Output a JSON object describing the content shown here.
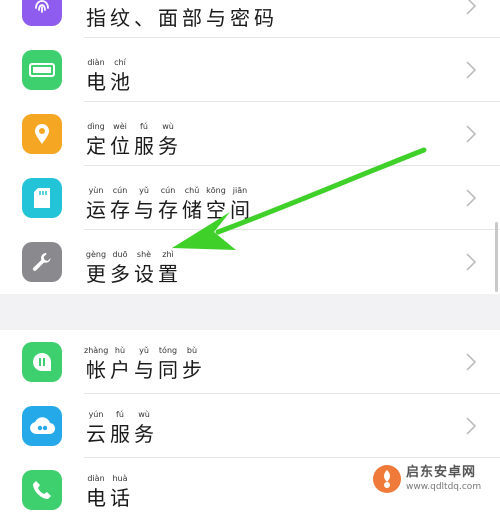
{
  "settings": {
    "items": [
      {
        "label_chars": [
          "指",
          "纹",
          "、",
          "面",
          "部",
          "与",
          "密",
          "码"
        ],
        "pinyin": [
          "",
          "",
          "",
          "",
          "",
          "",
          "",
          ""
        ],
        "icon": "fingerprint-icon",
        "color": "#8f5cf0"
      },
      {
        "label_chars": [
          "电",
          "池"
        ],
        "pinyin": [
          "diàn",
          "chí"
        ],
        "icon": "battery-icon",
        "color": "#3ecf6e"
      },
      {
        "label_chars": [
          "定",
          "位",
          "服",
          "务"
        ],
        "pinyin": [
          "dìng",
          "wèi",
          "fú",
          "wù"
        ],
        "icon": "location-icon",
        "color": "#f5a623"
      },
      {
        "label_chars": [
          "运",
          "存",
          "与",
          "存",
          "储",
          "空",
          "间"
        ],
        "pinyin": [
          "yùn",
          "cún",
          "yǔ",
          "cún",
          "chǔ",
          "kōng",
          "jiān"
        ],
        "icon": "sd-card-icon",
        "color": "#23c4d8"
      },
      {
        "label_chars": [
          "更",
          "多",
          "设",
          "置"
        ],
        "pinyin": [
          "gèng",
          "duō",
          "shè",
          "zhì"
        ],
        "icon": "wrench-icon",
        "color": "#8a8a8e"
      },
      {
        "label_chars": [
          "帐",
          "户",
          "与",
          "同",
          "步"
        ],
        "pinyin": [
          "zhàng",
          "hù",
          "yǔ",
          "tóng",
          "bù"
        ],
        "icon": "account-sync-icon",
        "color": "#3ecf6e"
      },
      {
        "label_chars": [
          "云",
          "服",
          "务"
        ],
        "pinyin": [
          "yún",
          "fú",
          "wù"
        ],
        "icon": "cloud-icon",
        "color": "#26a9e8"
      },
      {
        "label_chars": [
          "电",
          "话"
        ],
        "pinyin": [
          "diàn",
          "huà"
        ],
        "icon": "phone-icon",
        "color": "#3ecf6e"
      }
    ]
  },
  "annotation": {
    "arrow_color": "#3fd12a"
  },
  "watermark": {
    "title": "启东安卓网",
    "url": "www.qdltdq.com"
  }
}
